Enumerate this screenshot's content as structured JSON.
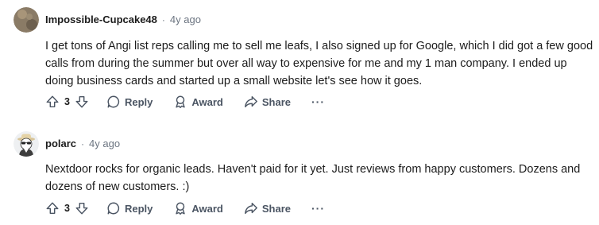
{
  "comments": [
    {
      "author": "Impossible-Cupcake48",
      "separator": "·",
      "time": "4y ago",
      "text": "I get tons of Angi list reps calling me to sell me leafs, I also signed up for Google, which I did got a few good calls from during the summer but over all way to expensive for me and my 1 man company. I ended up doing business cards and started up a small website let's see how it goes.",
      "votes": "3",
      "reply_label": "Reply",
      "award_label": "Award",
      "share_label": "Share",
      "more_label": "···"
    },
    {
      "author": "polarc",
      "separator": "·",
      "time": "4y ago",
      "text": "Nextdoor rocks for organic leads. Haven't paid for it yet. Just reviews from happy customers. Dozens and dozens of new customers. :)",
      "votes": "3",
      "reply_label": "Reply",
      "award_label": "Award",
      "share_label": "Share",
      "more_label": "···"
    }
  ]
}
